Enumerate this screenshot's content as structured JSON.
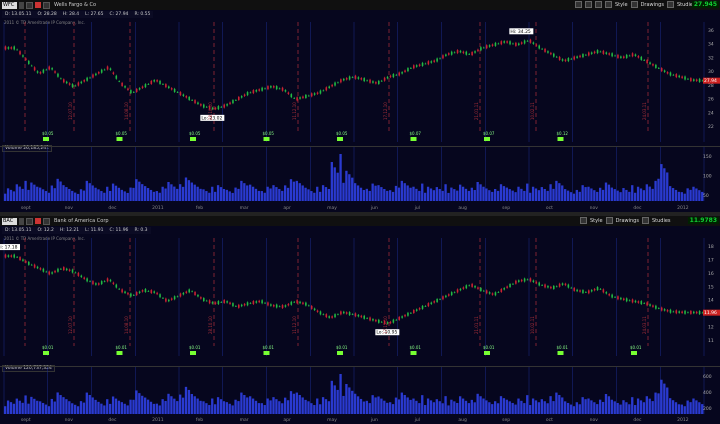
{
  "panels": [
    {
      "symbol": "WFC",
      "company": "Wells Fargo & Co",
      "info": [
        "D: 13.05.11",
        "O: 28.28",
        "H: 28.4",
        "L: 27.65",
        "C: 27.94",
        "R: 0.55"
      ],
      "last_price": "27.945",
      "price_color": "#11cc33",
      "price_tag": "27.94",
      "copyright": "2011 © TD Ameritrade IP Company, Inc.",
      "volume_label": "Volume",
      "volume_value": "26,185,241",
      "y_ticks": [
        "36",
        "34",
        "32",
        "30",
        "28",
        "26",
        "24",
        "22"
      ],
      "vol_ticks": [
        "150",
        "100",
        "50"
      ],
      "hi_label": "Hi: 34.25",
      "lo_label": "Lo: 23.02",
      "dividends": [
        "$0.05",
        "$0.05",
        "$0.05",
        "$0.05",
        "$0.05",
        "$0.07",
        "$0.07",
        "$0.12"
      ],
      "dates": [
        "12.07.10",
        "14.08.10",
        "28.10.10",
        "11.12.10",
        "17.12.10",
        "21.01.11",
        "10.02.11",
        "24.03.11"
      ],
      "series": [
        33,
        31,
        29,
        30,
        28,
        27,
        28,
        29,
        30,
        27.5,
        26,
        27,
        28,
        27,
        26,
        25,
        24,
        23.5,
        24,
        25,
        26,
        26.5,
        27,
        26.5,
        25,
        25.5,
        26,
        27,
        28,
        28.5,
        28,
        27.5,
        28.5,
        29,
        30,
        30.5,
        31,
        32,
        32.5,
        32,
        33,
        33.5,
        34,
        33.5,
        34.2,
        33,
        32,
        31,
        31.5,
        32,
        32.5,
        32,
        31.5,
        32,
        31,
        30,
        29,
        28.5,
        28,
        27.9
      ],
      "vol": [
        40,
        60,
        55,
        45,
        70,
        50,
        35,
        60,
        45,
        55,
        40,
        65,
        50,
        45,
        60,
        70,
        55,
        45,
        50,
        40,
        60,
        55,
        45,
        50,
        65,
        60,
        45,
        50,
        140,
        90,
        60,
        55,
        50,
        45,
        60,
        55,
        45,
        50,
        40,
        55,
        60,
        45,
        50,
        40,
        55,
        45,
        50,
        60,
        40,
        50,
        45,
        55,
        40,
        50,
        45,
        60,
        110,
        50,
        40,
        45
      ]
    },
    {
      "symbol": "BAC",
      "company": "Bank of America Corp",
      "info": [
        "D: 13.05.11",
        "O: 12.2",
        "H: 12.21",
        "L: 11.91",
        "C: 11.96",
        "R: 0.3"
      ],
      "last_price": "11.9783",
      "price_color": "#11cc33",
      "price_tag": "11.96",
      "copyright": "2011 © TD Ameritrade IP Company, Inc.",
      "volume_label": "Volume",
      "volume_value": "120,737,324",
      "y_ticks": [
        "18",
        "17",
        "16",
        "15",
        "14",
        "13",
        "12",
        "11"
      ],
      "vol_ticks": [
        "600",
        "400",
        "200"
      ],
      "hi_label": "Hi: 17.18",
      "lo_label": "Lo: 10.95",
      "dividends": [
        "$0.01",
        "$0.01",
        "$0.01",
        "$0.01",
        "$0.01",
        "$0.01",
        "$0.01",
        "$0.01",
        "$0.01"
      ],
      "dates": [
        "12.07.10",
        "14.08.10",
        "28.10.10",
        "11.12.10",
        "17.12.10",
        "21.01.11",
        "10.02.11",
        "24.03.11"
      ],
      "series": [
        17.1,
        16.5,
        16,
        15.5,
        16,
        15.7,
        15,
        14.5,
        15,
        14,
        13.5,
        14,
        13.8,
        13,
        13.5,
        14,
        13.2,
        12.8,
        13,
        12.5,
        12.8,
        13,
        12.6,
        12.5,
        13,
        12.7,
        12,
        11.5,
        12,
        11.8,
        11.5,
        11.2,
        11,
        11.5,
        12,
        12.5,
        13,
        13.5,
        14,
        14.5,
        14,
        13.6,
        14.2,
        14.8,
        15,
        14.5,
        14.2,
        14.6,
        14,
        13.8,
        14.2,
        13.5,
        13.2,
        13,
        12.8,
        12.4,
        12.1,
        12,
        11.98,
        11.96
      ],
      "vol": [
        200,
        260,
        240,
        200,
        320,
        250,
        180,
        300,
        220,
        260,
        200,
        330,
        260,
        220,
        300,
        380,
        280,
        230,
        250,
        200,
        300,
        280,
        230,
        250,
        320,
        300,
        230,
        250,
        560,
        420,
        320,
        280,
        260,
        230,
        300,
        280,
        230,
        250,
        200,
        280,
        300,
        230,
        250,
        200,
        280,
        230,
        250,
        300,
        200,
        250,
        230,
        280,
        200,
        250,
        230,
        300,
        480,
        250,
        200,
        230
      ]
    }
  ],
  "month_labels": [
    "sept",
    "nov",
    "dec",
    "2011",
    "feb",
    "mar",
    "apr",
    "may",
    "jun",
    "jul",
    "aug",
    "sep",
    "oct",
    "nov",
    "dec",
    "2012"
  ],
  "toolbar": {
    "style": "Style",
    "drawings": "Drawings",
    "studies": "Studies"
  },
  "colors": {
    "up": "#22bb44",
    "down": "#cc2233",
    "grid": "#1a2a8a",
    "event": "#b0303a",
    "volume": "#2a3ad0"
  }
}
